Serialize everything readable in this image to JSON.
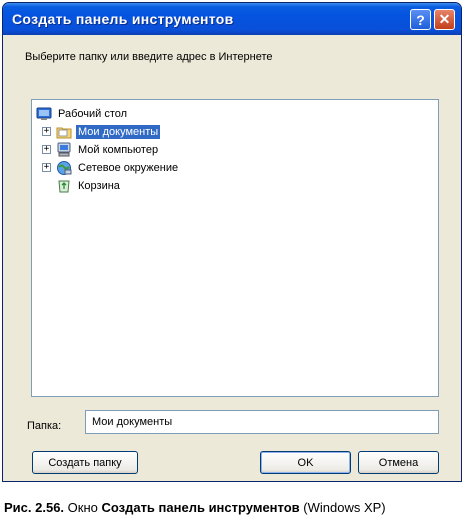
{
  "window": {
    "title": "Создать панель инструментов",
    "help_label": "?",
    "close_label": "✕"
  },
  "instruction": "Выберите папку или введите адрес  в Интернете",
  "tree": {
    "items": [
      {
        "label": "Рабочий стол",
        "icon": "desktop-icon"
      },
      {
        "label": "Мои документы",
        "icon": "my-documents-folder-icon",
        "selected": true
      },
      {
        "label": "Мой компьютер",
        "icon": "my-computer-icon"
      },
      {
        "label": "Сетевое окружение",
        "icon": "network-icon"
      },
      {
        "label": "Корзина",
        "icon": "recycle-bin-icon"
      }
    ],
    "expander": "+"
  },
  "folder": {
    "label": "Папка:",
    "value": "Мои документы"
  },
  "buttons": {
    "new_folder": "Создать папку",
    "ok": "OK",
    "cancel": "Отмена"
  },
  "caption": {
    "prefix": "Рис. 2.56.",
    "window_word": " Окно ",
    "name": "Создать панель инструментов",
    "suffix": " (Windows XP)"
  }
}
